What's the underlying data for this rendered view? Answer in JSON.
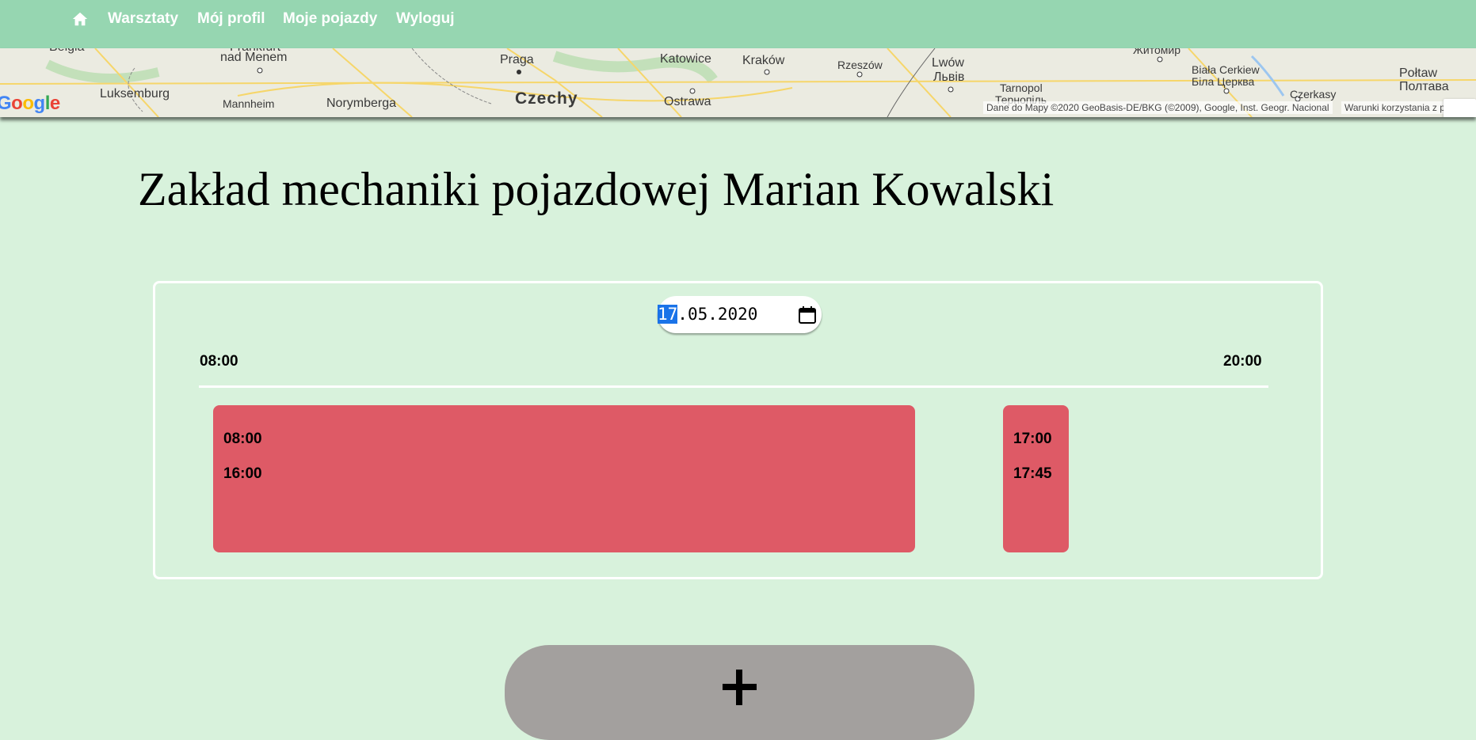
{
  "nav": {
    "home_icon": "home-icon",
    "links": [
      "Warsztaty",
      "Mój profil",
      "Moje pojazdy",
      "Wyloguj"
    ]
  },
  "map": {
    "labels": {
      "belgia": "Belgia",
      "frankfurt": "Frankfurt",
      "nad_menem": "nad Menem",
      "luksemburg": "Luksemburg",
      "mannheim": "Mannheim",
      "norymberga": "Norymberga",
      "praga": "Praga",
      "czechy": "Czechy",
      "katowice": "Katowice",
      "krakow": "Kraków",
      "ostrawa": "Ostrawa",
      "rzeszow": "Rzeszów",
      "lwow": "Lwów",
      "lviv": "Львів",
      "tarnopol": "Tarnopol",
      "ternopil": "Тернопіль",
      "zhytomyr": "Житомир",
      "biala_cerkiew": "Biała Cerkiew",
      "bila_tserkva": "Біла Церква",
      "czerkasy": "Czerkasy",
      "poltawa": "Połtaw",
      "poltava": "Полтава"
    },
    "google_logo": "Google",
    "attribution": "Dane do Mapy ©2020 GeoBasis-DE/BKG (©2009), Google, Inst. Geogr. Nacional",
    "terms": "Warunki korzystania z programu"
  },
  "page": {
    "title": "Zakład mechaniki pojazdowej Marian Kowalski"
  },
  "schedule": {
    "date": {
      "day": "17",
      "rest": ".05.2020"
    },
    "start_label": "08:00",
    "end_label": "20:00",
    "slots": [
      {
        "from": "08:00",
        "to": "16:00"
      },
      {
        "from": "17:00",
        "to": "17:45"
      }
    ],
    "slot_color": "#de5a66"
  },
  "add_button": {
    "icon": "plus-icon"
  }
}
